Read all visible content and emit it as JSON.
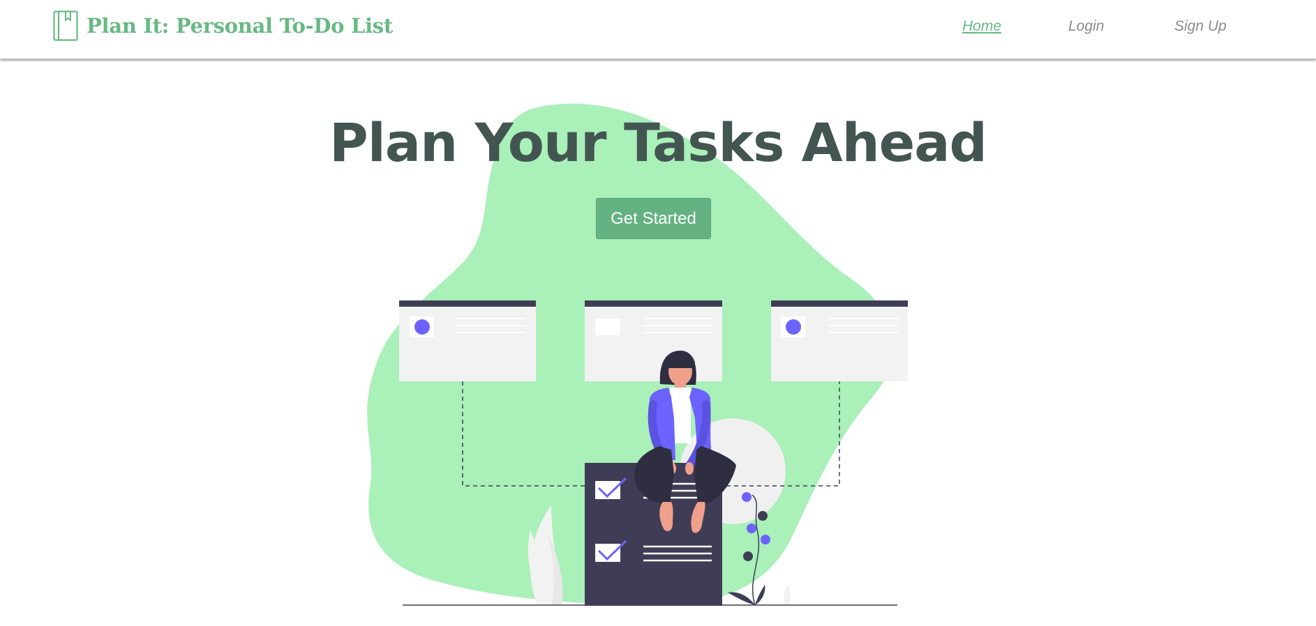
{
  "navbar": {
    "brand_title": "Plan It: Personal To-Do List",
    "links": [
      {
        "label": "Home",
        "active": true
      },
      {
        "label": "Login",
        "active": false
      },
      {
        "label": "Sign Up",
        "active": false
      }
    ]
  },
  "hero": {
    "title": "Plan Your Tasks Ahead",
    "cta_label": "Get Started"
  },
  "icons": {
    "brand": "bookmark-book-icon"
  },
  "colors": {
    "brand_green": "#68b984",
    "button_green": "#64b282",
    "blob_green": "#a9f0b9",
    "heading": "#435551",
    "accent_purple": "#6c63ff",
    "dark_card": "#3f3d56"
  }
}
